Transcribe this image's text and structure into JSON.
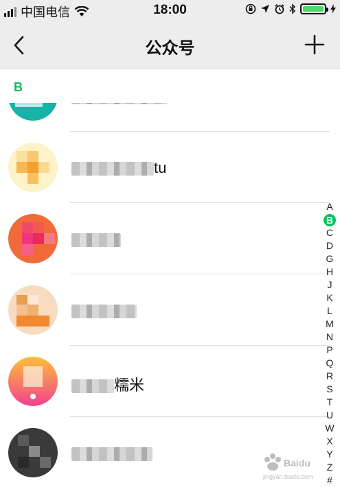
{
  "status_bar": {
    "carrier": "中国电信",
    "time": "18:00",
    "battery_level": 0.95,
    "icons": [
      "signal-icon",
      "wifi-icon",
      "rotation-lock-icon",
      "location-icon",
      "alarm-icon",
      "bluetooth-icon",
      "battery-icon",
      "charging-icon"
    ]
  },
  "nav": {
    "title": "公众号",
    "back_icon": "chevron-left-icon",
    "add_icon": "plus-icon"
  },
  "section": {
    "letter": "B"
  },
  "accounts": [
    {
      "name_visible": ""
    },
    {
      "name_visible": "tu"
    },
    {
      "name_visible": ""
    },
    {
      "name_visible": ""
    },
    {
      "name_visible": "糯米"
    },
    {
      "name_visible": ""
    }
  ],
  "index_letters": [
    "A",
    "B",
    "C",
    "D",
    "G",
    "H",
    "J",
    "K",
    "L",
    "M",
    "N",
    "P",
    "Q",
    "R",
    "S",
    "T",
    "U",
    "W",
    "X",
    "Y",
    "Z",
    "#"
  ],
  "active_index": "B",
  "colors": {
    "accent": "#07c160",
    "battery": "#4cd964",
    "nav_bg": "#ededed"
  }
}
